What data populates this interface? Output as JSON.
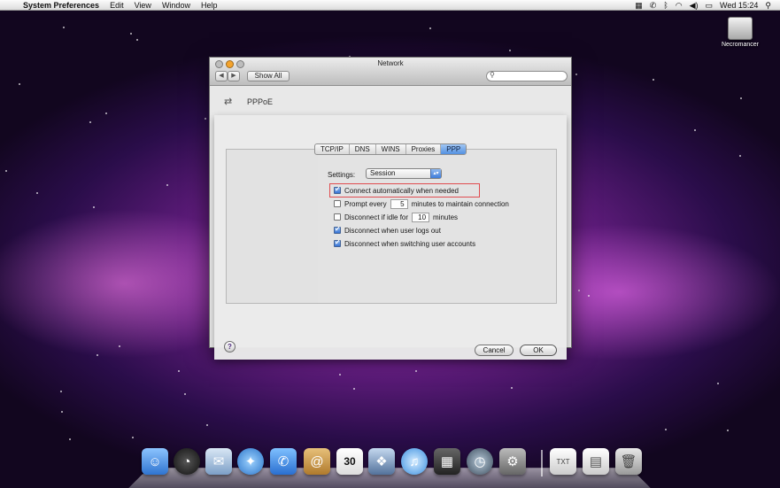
{
  "menubar": {
    "app_name": "System Preferences",
    "menus": [
      "Edit",
      "View",
      "Window",
      "Help"
    ],
    "clock": "Wed 15:24"
  },
  "desktop": {
    "drive_label": "Necromancer"
  },
  "window": {
    "title": "Network",
    "show_all_label": "Show All",
    "search_placeholder": "",
    "service_name": "PPPoE"
  },
  "sheet": {
    "tabs": [
      {
        "label": "TCP/IP",
        "active": false
      },
      {
        "label": "DNS",
        "active": false
      },
      {
        "label": "WINS",
        "active": false
      },
      {
        "label": "Proxies",
        "active": false
      },
      {
        "label": "PPP",
        "active": true
      }
    ],
    "settings_label": "Settings:",
    "settings_value": "Session",
    "options": {
      "connect_auto": {
        "label": "Connect automatically when needed",
        "checked": true
      },
      "prompt_every": {
        "label_before": "Prompt every",
        "value": "5",
        "label_after": "minutes to maintain connection",
        "checked": false
      },
      "disconnect_idle": {
        "label_before": "Disconnect if idle for",
        "value": "10",
        "label_after": "minutes",
        "checked": false
      },
      "disconnect_logout": {
        "label": "Disconnect when user logs out",
        "checked": true
      },
      "disconnect_switch": {
        "label": "Disconnect when switching user accounts",
        "checked": true
      }
    },
    "help_label": "?",
    "cancel_label": "Cancel",
    "ok_label": "OK"
  },
  "colors": {
    "accent": "#3b7ad9",
    "highlight_box": "#e0474c"
  }
}
